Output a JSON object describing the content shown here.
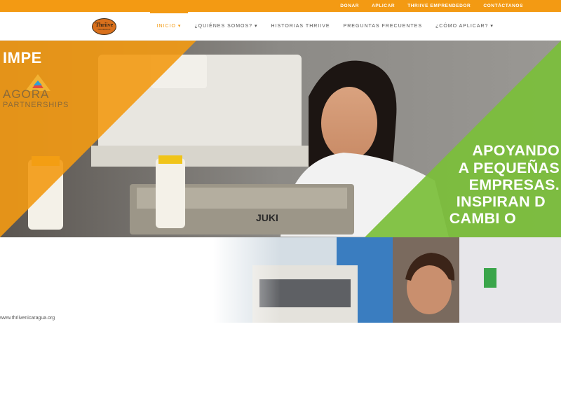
{
  "topbar": {
    "links": [
      "DONAR",
      "APLICAR",
      "THRIIVE EMPRENDEDOR",
      "CONTÁCTANOS"
    ]
  },
  "logo": {
    "main": "Thriive",
    "sub": "NICARAGUA"
  },
  "nav": {
    "items": [
      {
        "label": "INICIO ▾"
      },
      {
        "label": "¿QUIÉNES SOMOS? ▾"
      },
      {
        "label": "HISTORIAS THRIIVE"
      },
      {
        "label": "PREGUNTAS FRECUENTES"
      },
      {
        "label": "¿CÓMO APLICAR? ▾"
      }
    ]
  },
  "hero": {
    "impe_text": "IMPE",
    "agora": {
      "line1": "AGORA",
      "line2": "PARTNERSHIPS"
    },
    "slogan": [
      "APOYANDO",
      "A PEQUEÑAS",
      "EMPRESAS.",
      "INSPIRAN    D",
      "CAMBI     O"
    ],
    "machine_brand": "JUKI",
    "overlay_colors": {
      "orange": "#f39a13",
      "green": "#7bbf3a"
    }
  },
  "footer": {
    "url": "www.thriivenicaragua.org"
  }
}
